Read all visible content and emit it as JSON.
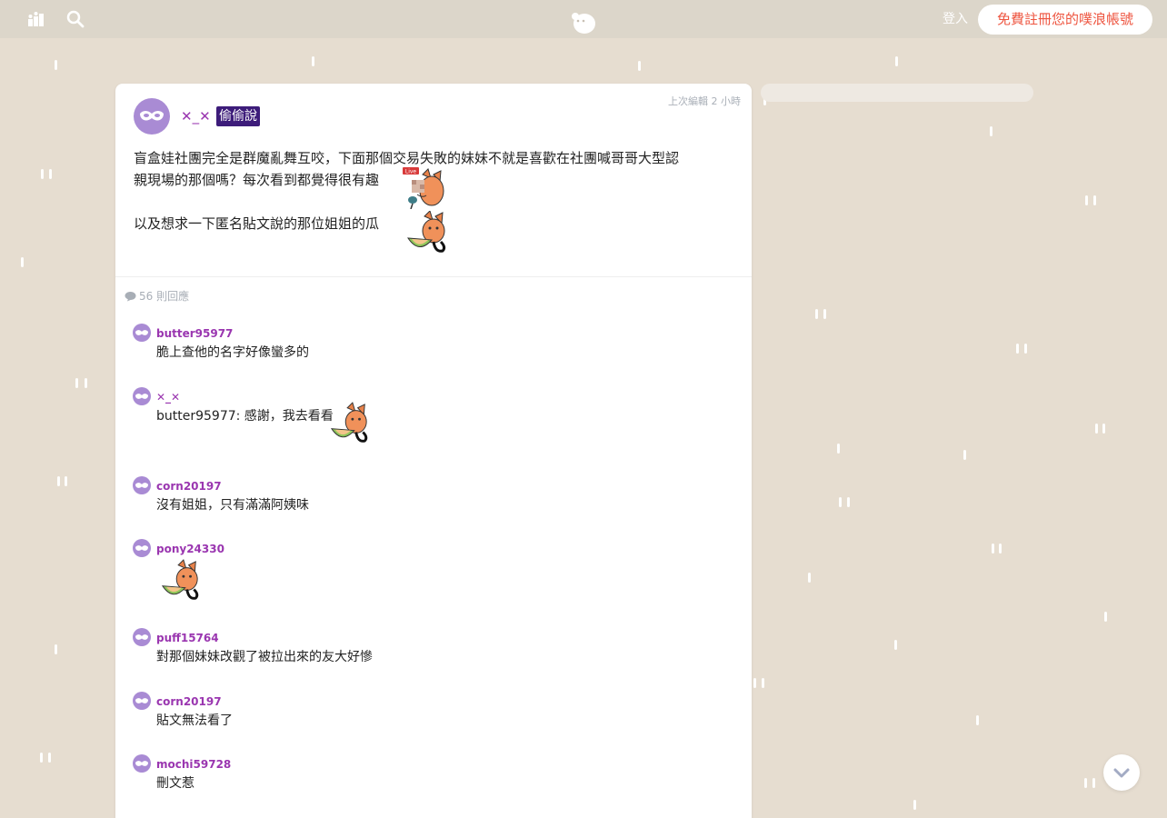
{
  "header": {
    "login_label": "登入",
    "signup_label": "免費註冊您的噗浪帳號"
  },
  "post": {
    "author": "✕_✕",
    "badge": "偷偷說",
    "edited": "上次編輯 2 小時",
    "lines": [
      "盲盒娃社團完全是群魔亂舞互咬，下面那個交易失敗的妹妹不就是喜歡在社團喊哥哥大型認",
      "親現場的那個嗎？每次看到都覺得很有趣",
      "以及想求一下匿名貼文說的那位姐姐的瓜"
    ],
    "sticker_live_label": "Live"
  },
  "replies_header": {
    "count_label": "56 則回應"
  },
  "replies": [
    {
      "name": "butter95977",
      "text": "脆上查他的名字好像蠻多的"
    },
    {
      "name": "✕_✕",
      "text": "butter95977: 感謝，我去看看"
    },
    {
      "name": "corn20197",
      "text": "沒有姐姐，只有滿滿阿姨味"
    },
    {
      "name": "pony24330",
      "text": ""
    },
    {
      "name": "puff15764",
      "text": "對那個妹妹改觀了被拉出來的友大好慘"
    },
    {
      "name": "corn20197",
      "text": "貼文無法看了"
    },
    {
      "name": "mochi59728",
      "text": "刪文惹"
    }
  ],
  "icons": {
    "timeline": "timeline-icon",
    "search": "search-icon",
    "logo": "plurk-logo-icon",
    "avatar": "anonymous-mask-icon",
    "scroll": "chevron-down-icon"
  },
  "colors": {
    "background": "#e6ddd0",
    "topbar": "#dcd6ca",
    "username": "#9a36b0",
    "badge": "#3d1c7a",
    "signup_text": "#ee5540",
    "avatar": "#a98bd4"
  }
}
